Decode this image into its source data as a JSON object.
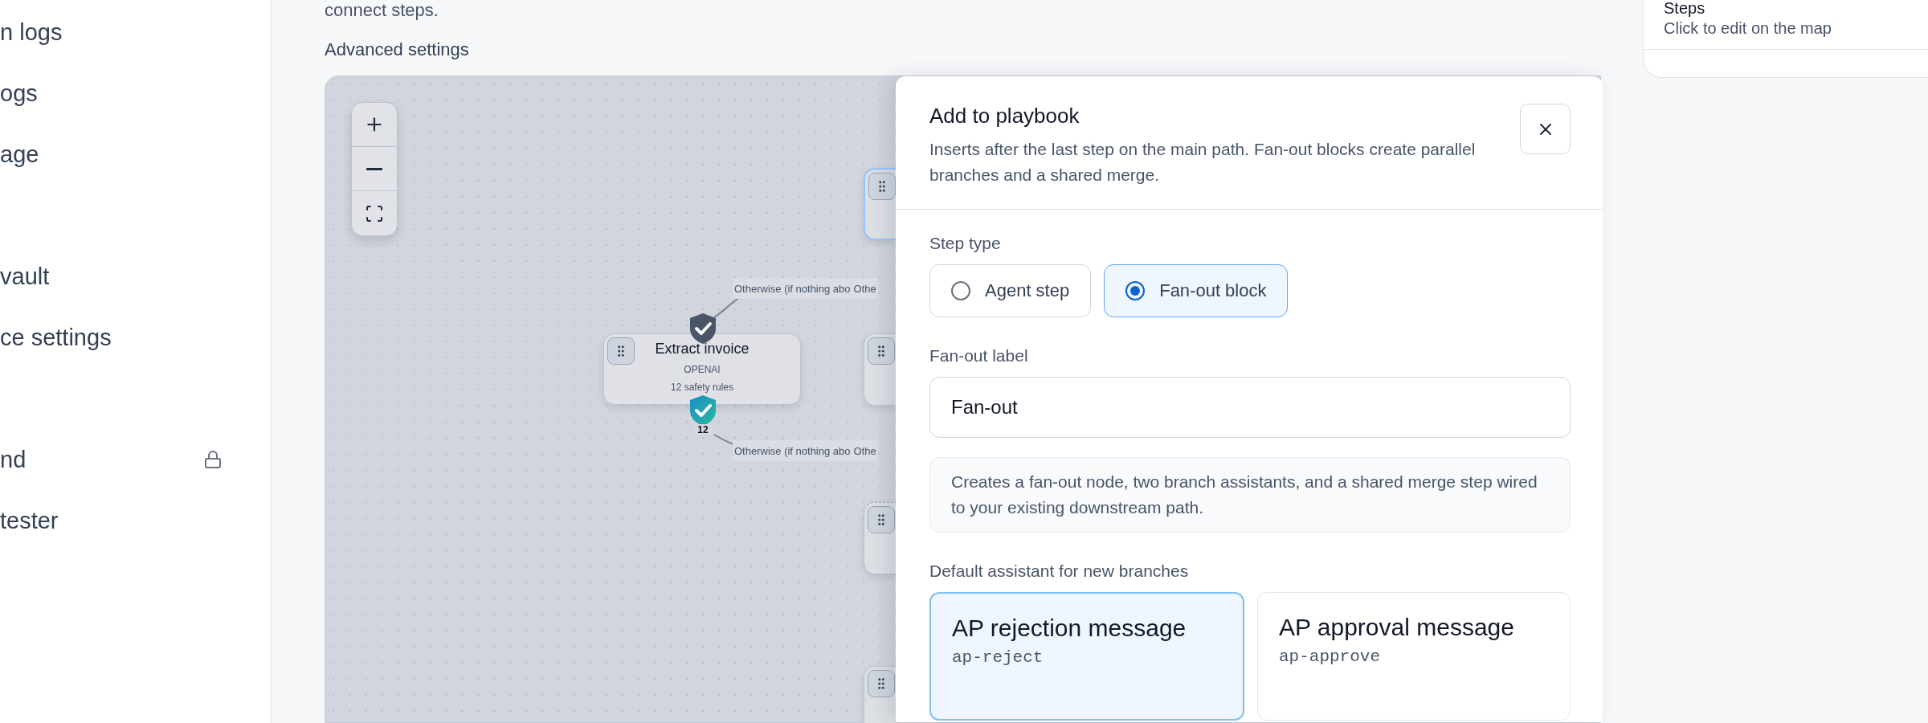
{
  "sidebar": {
    "items": [
      {
        "label": "n logs",
        "selected": false,
        "locked": false
      },
      {
        "label": "ogs",
        "selected": false,
        "locked": false
      },
      {
        "label": "age",
        "selected": false,
        "locked": false
      },
      {
        "label": "vault",
        "selected": false,
        "locked": false
      },
      {
        "label": "ce settings",
        "selected": false,
        "locked": false
      },
      {
        "label": "nd",
        "selected": false,
        "locked": true
      },
      {
        "label": "tester",
        "selected": false,
        "locked": false
      }
    ]
  },
  "main": {
    "intro": "connect steps.",
    "advanced_settings": "Advanced settings"
  },
  "canvas": {
    "zoom_controls": [
      {
        "kind": "zoom-in"
      },
      {
        "kind": "zoom-out"
      },
      {
        "kind": "fit"
      }
    ],
    "node": {
      "title": "Extract invoice",
      "provider": "OPENAI",
      "rules": "12 safety rules",
      "rule_count": "12"
    },
    "edge_labels": [
      {
        "parts": [
          "Otherwise (if nothing abo",
          "Othe"
        ]
      },
      {
        "parts": [
          "Otherwise (if nothing abo",
          "Othe"
        ]
      }
    ],
    "partial_nodes": [
      {
        "kind": "solid",
        "selected": true
      },
      {
        "kind": "solid",
        "selected": false
      },
      {
        "kind": "dashed",
        "selected": false
      },
      {
        "kind": "solid",
        "selected": false
      }
    ]
  },
  "dialog": {
    "title": "Add to playbook",
    "description": "Inserts after the last step on the main path. Fan-out blocks create parallel branches and a shared merge.",
    "step_type_label": "Step type",
    "step_types": [
      {
        "label": "Agent step",
        "selected": false
      },
      {
        "label": "Fan-out block",
        "selected": true
      }
    ],
    "fan_out_label": "Fan-out label",
    "fan_out_value": "Fan-out",
    "info": "Creates a fan-out node, two branch assistants, and a shared merge step wired to your existing downstream path.",
    "assistant_label": "Default assistant for new branches",
    "assistants": [
      {
        "name": "AP rejection message",
        "slug": "ap-reject",
        "selected": true
      },
      {
        "name": "AP approval message",
        "slug": "ap-approve",
        "selected": false
      }
    ]
  },
  "right_panel": {
    "title": "Steps",
    "subtitle": "Click to edit on the map"
  }
}
